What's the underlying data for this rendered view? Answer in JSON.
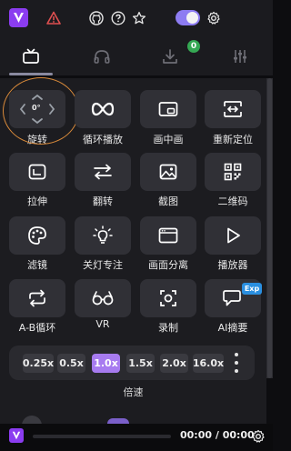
{
  "header": {
    "icons": [
      "logo-icon",
      "warning-icon",
      "github-icon",
      "help-icon",
      "star-icon",
      "toggle",
      "settings-icon"
    ],
    "toggle_on": true
  },
  "tabs": {
    "items": [
      "tv-icon",
      "headphones-icon",
      "download-icon",
      "equalizer-icon"
    ],
    "active_index": 0,
    "download_badge": "0"
  },
  "tools": {
    "rotate": {
      "label": "旋转",
      "degree": "0°"
    },
    "loop": {
      "label": "循环播放"
    },
    "pip": {
      "label": "画中画"
    },
    "reposition": {
      "label": "重新定位"
    },
    "stretch": {
      "label": "拉伸"
    },
    "flip": {
      "label": "翻转"
    },
    "screenshot": {
      "label": "截图"
    },
    "qrcode": {
      "label": "二维码"
    },
    "filter": {
      "label": "滤镜"
    },
    "focus": {
      "label": "关灯专注"
    },
    "split": {
      "label": "画面分离"
    },
    "player": {
      "label": "播放器"
    },
    "ab_loop": {
      "label": "A-B循环"
    },
    "vr": {
      "label": "VR"
    },
    "record": {
      "label": "录制"
    },
    "ai_summary": {
      "label": "AI摘要",
      "badge": "Exp"
    }
  },
  "speed": {
    "title": "倍速",
    "options": [
      "0.25x",
      "0.5x",
      "1.0x",
      "1.5x",
      "2.0x",
      "16.0x"
    ],
    "active": "1.0x"
  },
  "player": {
    "time": "00:00 / 00:00"
  },
  "colors": {
    "accent": "#8b3cf0",
    "speed_active": "#a77bf0",
    "badge_green": "#35a853",
    "badge_blue": "#2a8fe0",
    "highlight_ring": "#d98a3a"
  }
}
